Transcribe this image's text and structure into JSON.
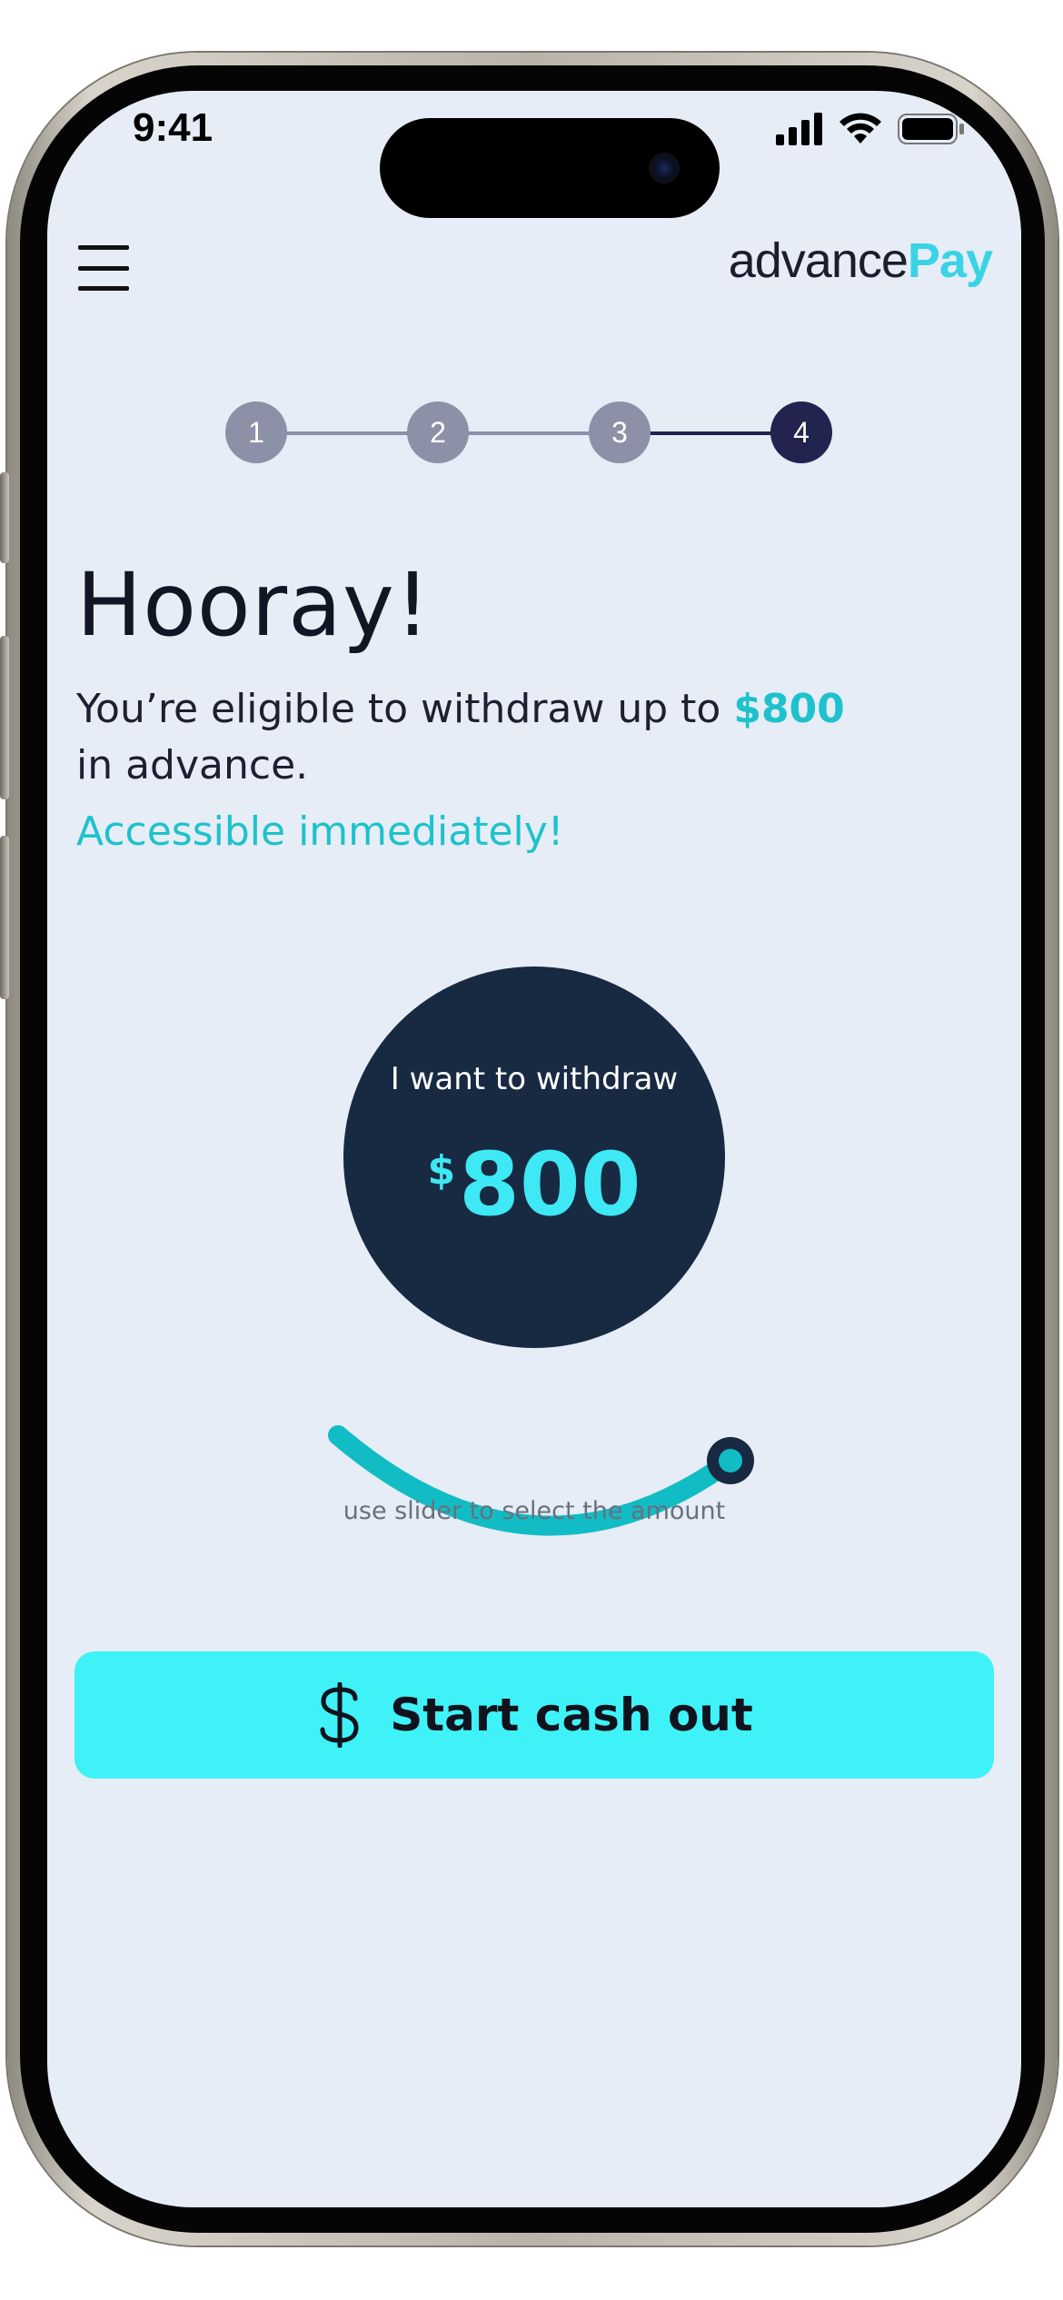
{
  "status_bar": {
    "time": "9:41",
    "icons": [
      "cellular-signal-icon",
      "wifi-icon",
      "battery-icon"
    ]
  },
  "header": {
    "logo": {
      "part1": "advance",
      "part2": "Pay"
    },
    "menu_icon": "hamburger-menu-icon"
  },
  "stepper": {
    "steps": [
      "1",
      "2",
      "3",
      "4"
    ],
    "current_step": 4
  },
  "main": {
    "title": "Hooray!",
    "eligible_text_before": "You’re eligible to withdraw up to",
    "eligible_amount": "$800",
    "eligible_text_after": "in advance.",
    "accessible_text": "Accessible immediately!",
    "withdraw_label": "I want to withdraw",
    "withdraw_currency": "$",
    "withdraw_value": "800",
    "slider_hint": "use slider to select the amount",
    "slider_fraction": 1.0
  },
  "cta": {
    "icon": "dollar-icon",
    "label": "Start cash out"
  },
  "colors": {
    "background": "#e6edf6",
    "accent": "#3ff2f7",
    "teal": "#1dc2cc",
    "circle": "#172a42",
    "step_done": "#8c91a8",
    "step_active": "#22244f"
  }
}
